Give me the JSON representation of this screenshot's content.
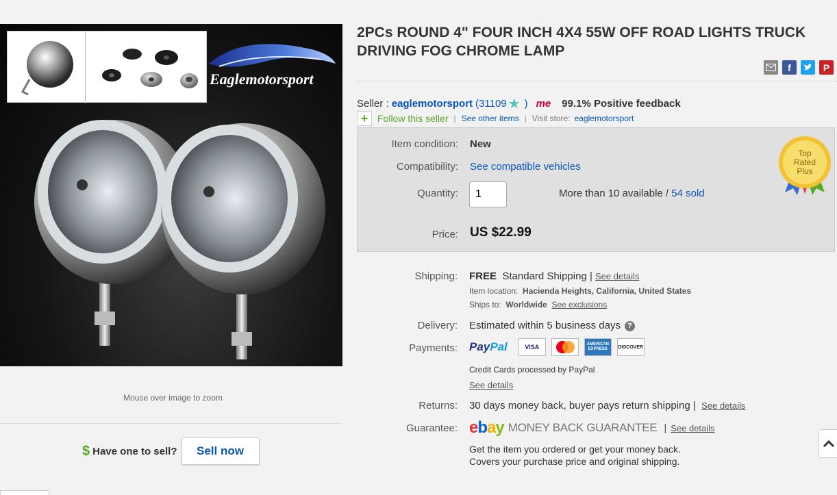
{
  "title": "2PCs ROUND 4\" FOUR INCH 4X4 55W OFF ROAD LIGHTS TRUCK DRIVING FOG CHROME LAMP",
  "image": {
    "brand_logo_text": "Eaglemotorsport",
    "zoom_hint": "Mouse over image to zoom"
  },
  "sell": {
    "dollar": "$",
    "prompt": "Have one to sell?",
    "button": "Sell now"
  },
  "share_icons": [
    "email-icon",
    "facebook-icon",
    "twitter-icon",
    "pinterest-icon"
  ],
  "seller": {
    "label": "Seller :",
    "name": "eaglemotorsport",
    "score_open": "(31109",
    "score_close": ")",
    "me_badge": "me",
    "feedback": "99.1% Positive feedback",
    "follow": "Follow this seller",
    "see_other": "See other items",
    "visit_store_label": "Visit store:",
    "store_name": "eaglemotorsport"
  },
  "item": {
    "condition_label": "Item condition:",
    "condition": "New",
    "compat_label": "Compatibility:",
    "compat_link": "See compatible vehicles",
    "qty_label": "Quantity:",
    "qty_value": "1",
    "available": "More than 10 available /",
    "sold": "54 sold",
    "price_label": "Price:",
    "price": "US $22.99",
    "badge": [
      "Top",
      "Rated",
      "Plus"
    ]
  },
  "shipping": {
    "label": "Shipping:",
    "free": "FREE",
    "method": "Standard Shipping |",
    "details": "See details",
    "location_label": "Item location:",
    "location": "Hacienda Heights, California, United States",
    "ships_label": "Ships to:",
    "ships_to": "Worldwide",
    "exclusions": "See exclusions"
  },
  "delivery": {
    "label": "Delivery:",
    "text": "Estimated within 5 business days"
  },
  "payments": {
    "label": "Payments:",
    "paypal_a": "Pay",
    "paypal_b": "Pal",
    "cards": [
      "VISA",
      "MasterCard",
      "AMERICAN EXPRESS",
      "DISCOVER"
    ],
    "note": "Credit Cards processed by PayPal",
    "details": "See details"
  },
  "returns": {
    "label": "Returns:",
    "text": "30 days money back, buyer pays return shipping |",
    "details": "See details"
  },
  "guarantee": {
    "label": "Guarantee:",
    "mbg": "MONEY BACK GUARANTEE",
    "sep": "|",
    "details": "See details",
    "line1": "Get the item you ordered or get your money back.",
    "line2": "Covers your purchase price and original shipping."
  }
}
